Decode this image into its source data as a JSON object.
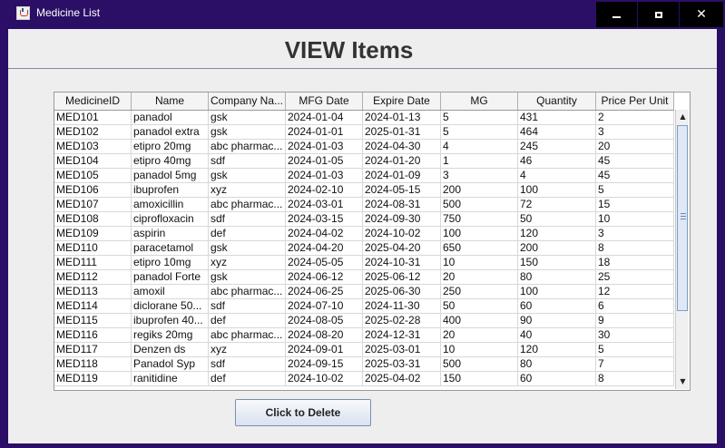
{
  "window": {
    "title": "Medicine List",
    "icon": "java-cup-icon"
  },
  "heading": "VIEW Items",
  "table": {
    "columns": [
      "MedicineID",
      "Name",
      "Company Na...",
      "MFG Date",
      "Expire Date",
      "MG",
      "Quantity",
      "Price Per Unit"
    ],
    "rows": [
      [
        "MED101",
        "panadol",
        "gsk",
        "2024-01-04",
        "2024-01-13",
        "5",
        "431",
        "2"
      ],
      [
        "MED102",
        "panadol extra",
        "gsk",
        "2024-01-01",
        "2025-01-31",
        "5",
        "464",
        "3"
      ],
      [
        "MED103",
        "etipro 20mg",
        "abc pharmac...",
        "2024-01-03",
        "2024-04-30",
        "4",
        "245",
        "20"
      ],
      [
        "MED104",
        "etipro 40mg",
        "sdf",
        "2024-01-05",
        "2024-01-20",
        "1",
        "46",
        "45"
      ],
      [
        "MED105",
        "panadol 5mg",
        "gsk",
        "2024-01-03",
        "2024-01-09",
        "3",
        "4",
        "45"
      ],
      [
        "MED106",
        "ibuprofen",
        "xyz",
        "2024-02-10",
        "2024-05-15",
        "200",
        "100",
        "5"
      ],
      [
        "MED107",
        "amoxicillin",
        "abc pharmac...",
        "2024-03-01",
        "2024-08-31",
        "500",
        "72",
        "15"
      ],
      [
        "MED108",
        "ciprofloxacin",
        "sdf",
        "2024-03-15",
        "2024-09-30",
        "750",
        "50",
        "10"
      ],
      [
        "MED109",
        "aspirin",
        "def",
        "2024-04-02",
        "2024-10-02",
        "100",
        "120",
        "3"
      ],
      [
        "MED110",
        "paracetamol",
        "gsk",
        "2024-04-20",
        "2025-04-20",
        "650",
        "200",
        "8"
      ],
      [
        "MED111",
        "etipro 10mg",
        "xyz",
        "2024-05-05",
        "2024-10-31",
        "10",
        "150",
        "18"
      ],
      [
        "MED112",
        "panadol Forte",
        "gsk",
        "2024-06-12",
        "2025-06-12",
        "20",
        "80",
        "25"
      ],
      [
        "MED113",
        "amoxil",
        "abc pharmac...",
        "2024-06-25",
        "2025-06-30",
        "250",
        "100",
        "12"
      ],
      [
        "MED114",
        "diclorane 50...",
        "sdf",
        "2024-07-10",
        "2024-11-30",
        "50",
        "60",
        "6"
      ],
      [
        "MED115",
        "ibuprofen 40...",
        "def",
        "2024-08-05",
        "2025-02-28",
        "400",
        "90",
        "9"
      ],
      [
        "MED116",
        "regiks 20mg",
        "abc pharmac...",
        "2024-08-20",
        "2024-12-31",
        "20",
        "40",
        "30"
      ],
      [
        "MED117",
        "Denzen ds",
        "xyz",
        "2024-09-01",
        "2025-03-01",
        "10",
        "120",
        "5"
      ],
      [
        "MED118",
        "Panadol Syp",
        "sdf",
        "2024-09-15",
        "2025-03-31",
        "500",
        "80",
        "7"
      ],
      [
        "MED119",
        "ranitidine",
        "def",
        "2024-10-02",
        "2025-04-02",
        "150",
        "60",
        "8"
      ]
    ]
  },
  "scrollbar": {
    "up": "▲",
    "down": "▼"
  },
  "delete_button": "Click to Delete",
  "titlebar_buttons": {
    "close": "✕"
  }
}
